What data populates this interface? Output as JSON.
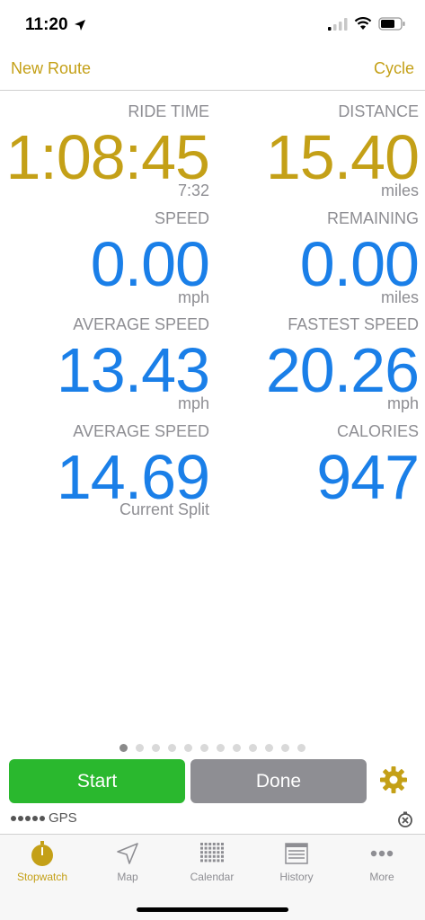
{
  "status_bar": {
    "time": "11:20"
  },
  "nav": {
    "left": "New Route",
    "right": "Cycle"
  },
  "colors": {
    "gold": "#c4a017",
    "blue": "#1a7fe8",
    "green": "#2ab82e",
    "gray_button": "#8e8e93",
    "label_gray": "#8e8e93"
  },
  "metrics": {
    "ride_time": {
      "label": "RIDE TIME",
      "value": "1:08:45",
      "sub": "7:32"
    },
    "distance": {
      "label": "DISTANCE",
      "value": "15.40",
      "unit": "miles"
    },
    "speed": {
      "label": "SPEED",
      "value": "0.00",
      "unit": "mph"
    },
    "remaining": {
      "label": "REMAINING",
      "value": "0.00",
      "unit": "miles"
    },
    "average_speed": {
      "label": "AVERAGE SPEED",
      "value": "13.43",
      "unit": "mph"
    },
    "fastest_speed": {
      "label": "FASTEST SPEED",
      "value": "20.26",
      "unit": "mph"
    },
    "average_speed_split": {
      "label": "AVERAGE SPEED",
      "value": "14.69",
      "unit": "Current Split"
    },
    "calories": {
      "label": "CALORIES",
      "value": "947"
    }
  },
  "pager": {
    "total": 12,
    "active_index": 0
  },
  "buttons": {
    "start": "Start",
    "done": "Done"
  },
  "gps": {
    "label": "GPS",
    "signal_dots": 5
  },
  "tabs": [
    {
      "label": "Stopwatch",
      "icon": "stopwatch-icon",
      "active": true
    },
    {
      "label": "Map",
      "icon": "location-arrow-icon",
      "active": false
    },
    {
      "label": "Calendar",
      "icon": "calendar-grid-icon",
      "active": false
    },
    {
      "label": "History",
      "icon": "history-list-icon",
      "active": false
    },
    {
      "label": "More",
      "icon": "more-dots-icon",
      "active": false
    }
  ]
}
